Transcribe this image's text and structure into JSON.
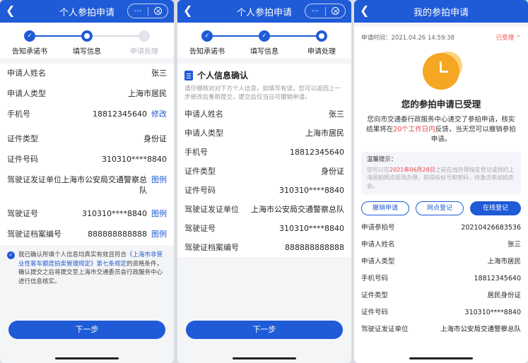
{
  "screen1": {
    "header": {
      "title": "个人参拍申请",
      "more": "···"
    },
    "steps": [
      "告知承诺书",
      "填写信息",
      "申请处理"
    ],
    "rows": [
      {
        "k": "申请人姓名",
        "v": "张三",
        "a": ""
      },
      {
        "k": "申请人类型",
        "v": "上海市居民",
        "a": ""
      },
      {
        "k": "手机号",
        "v": "18812345640",
        "a": "修改"
      },
      {
        "k": "证件类型",
        "v": "身份证",
        "a": ""
      },
      {
        "k": "证件号码",
        "v": "310310****8840",
        "a": ""
      },
      {
        "k": "驾驶证发证单位",
        "v": "上海市公安局交通警察总队",
        "a": "图例"
      },
      {
        "k": "驾驶证号",
        "v": "310310****8840",
        "a": "图例"
      },
      {
        "k": "驾驶证档案编号",
        "v": "888888888888",
        "a": "图例"
      }
    ],
    "agree": {
      "pre": "我已确认所填个人信息均真实有效且符合",
      "link": "《上海市非营业性客车额度拍卖管理规定》第七条规定",
      "post": "的资格条件，确认提交之后将提交至上海市交通委员会行政服务中心进行信息核实。"
    },
    "next": "下一步"
  },
  "screen2": {
    "header": {
      "title": "个人参拍申请",
      "more": "···"
    },
    "steps": [
      "告知承诺书",
      "填写信息",
      "申请处理"
    ],
    "card_title": "个人信息确认",
    "hint": "请仔细核对对下方个人信息，如填写有误，您可以返回上一步修改后重新提交，提交后仅当日可撤销申请。",
    "rows": [
      {
        "k": "申请人姓名",
        "v": "张三"
      },
      {
        "k": "申请人类型",
        "v": "上海市居民"
      },
      {
        "k": "手机号",
        "v": "18812345640"
      },
      {
        "k": "证件类型",
        "v": "身份证"
      },
      {
        "k": "证件号码",
        "v": "310310****8840"
      },
      {
        "k": "驾驶证发证单位",
        "v": "上海市公安局交通警察总队"
      },
      {
        "k": "驾驶证号",
        "v": "310310****8840"
      },
      {
        "k": "驾驶证档案编号",
        "v": "888888888888"
      }
    ],
    "next": "下一步"
  },
  "screen3": {
    "header": {
      "title": "我的参拍申请"
    },
    "time_label": "申请时间：2021.04.26 14:59:38",
    "status": "已受理",
    "title": "您的参拍申请已受理",
    "desc_pre": "您向市交通委行政服务中心递交了参拍申请，核实结果将在",
    "desc_red": "20个工作日内",
    "desc_post": "反馈，当天您可以撤销参拍申请。",
    "tips_title": "温馨提示：",
    "tips_pre": "您可以在",
    "tips_red": "2021年06月28日",
    "tips_post": "之前在线办理指定登记或预约上海国拍网点现场办理，获得投标号和密码，待激活参加拍卖会。",
    "buttons": {
      "cancel": "撤销申请",
      "outlet": "网点登记",
      "online": "在线登记"
    },
    "rows": [
      {
        "k": "申请参拍号",
        "v": "20210426683536"
      },
      {
        "k": "申请人姓名",
        "v": "张三"
      },
      {
        "k": "申请人类型",
        "v": "上海市居民"
      },
      {
        "k": "手机号码",
        "v": "18812345640"
      },
      {
        "k": "证件类型",
        "v": "居民身份证"
      },
      {
        "k": "证件号码",
        "v": "310310****8840"
      },
      {
        "k": "驾驶证发证单位",
        "v": "上海市公安局交通警察总队"
      }
    ]
  }
}
